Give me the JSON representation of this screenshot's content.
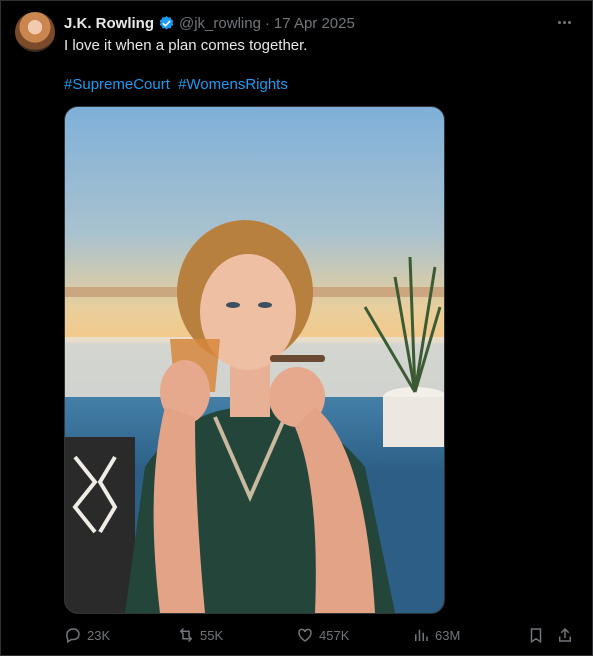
{
  "post": {
    "author_name": "J.K. Rowling",
    "handle": "@jk_rowling",
    "separator": "·",
    "date": "17 Apr 2025",
    "text": "I love it when a plan comes together.",
    "hashtags": [
      "#SupremeCourt",
      "#WomensRights"
    ]
  },
  "actions": {
    "replies": "23K",
    "reposts": "55K",
    "likes": "457K",
    "views": "63M"
  },
  "colors": {
    "background": "#000000",
    "primary_text": "#e7e9ea",
    "secondary_text": "#71767b",
    "link": "#1d9bf0",
    "verified": "#1d9bf0"
  },
  "icons": {
    "verified": "verified-badge-icon",
    "more": "more-icon",
    "reply": "reply-icon",
    "repost": "repost-icon",
    "like": "heart-icon",
    "views": "views-icon",
    "bookmark": "bookmark-icon",
    "share": "share-icon"
  }
}
